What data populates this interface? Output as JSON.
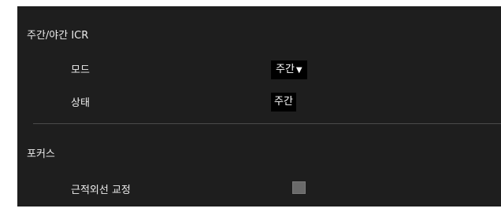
{
  "day_night_icr": {
    "title": "주간/야간 ICR",
    "mode_label": "모드",
    "mode_value": "주간",
    "mode_arrow": "▼",
    "status_label": "상태",
    "status_value": "주간"
  },
  "focus": {
    "title": "포커스",
    "ir_correction_label": "근적외선 교정",
    "ir_correction_checked": false
  },
  "colors": {
    "panel_background": "#1e1e1e",
    "text": "#ededed",
    "field_background": "#000000",
    "checkbox": "#6a6a6a",
    "divider": "#4a4a4a"
  }
}
